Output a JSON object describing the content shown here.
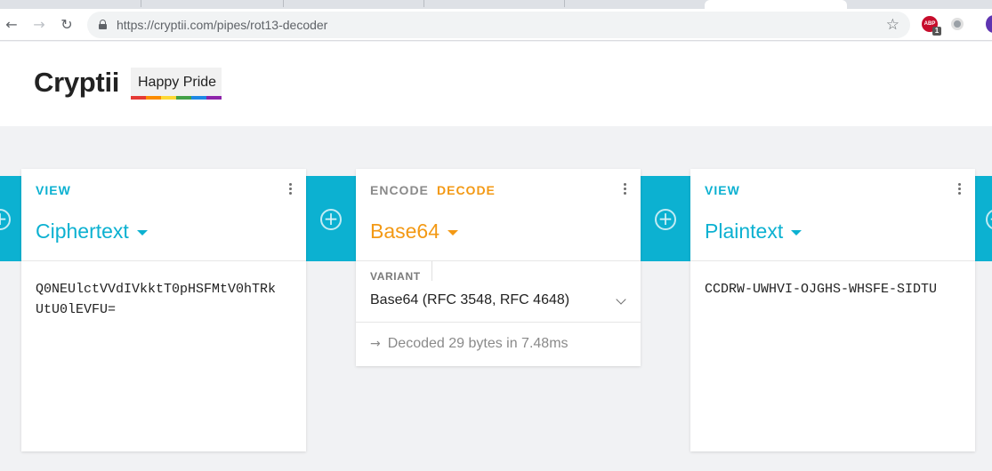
{
  "browser": {
    "url_host": "https://cryptii.com",
    "url_path": "/pipes/rot13-decoder",
    "extensions": [
      "adblock-plus",
      "circle-extension",
      "profile-avatar"
    ],
    "abp_label": "ABP",
    "abp_badge": "1"
  },
  "header": {
    "logo": "Cryptii",
    "pride_label": "Happy Pride",
    "pride_colors": [
      "#e53935",
      "#fb8c00",
      "#fdd835",
      "#43a047",
      "#1e88e5",
      "#8e24aa"
    ]
  },
  "colors": {
    "accent": "#0cb1d1",
    "decode": "#f39914"
  },
  "bricks": {
    "ciphertext": {
      "head": "VIEW",
      "title": "Ciphertext",
      "content_line1": "Q0NEUlctVVdIVkktT0pHSFMtV0hTRk",
      "content_line2": "UtU0lEVFU="
    },
    "base64": {
      "encode": "ENCODE",
      "decode": "DECODE",
      "title": "Base64",
      "variant_label": "VARIANT",
      "variant_value": "Base64 (RFC 3548, RFC 4648)",
      "status_arrow": "→",
      "status": "Decoded 29 bytes in 7.48ms"
    },
    "plaintext": {
      "head": "VIEW",
      "title": "Plaintext",
      "content": "CCDRW-UWHVI-OJGHS-WHSFE-SIDTU"
    }
  }
}
